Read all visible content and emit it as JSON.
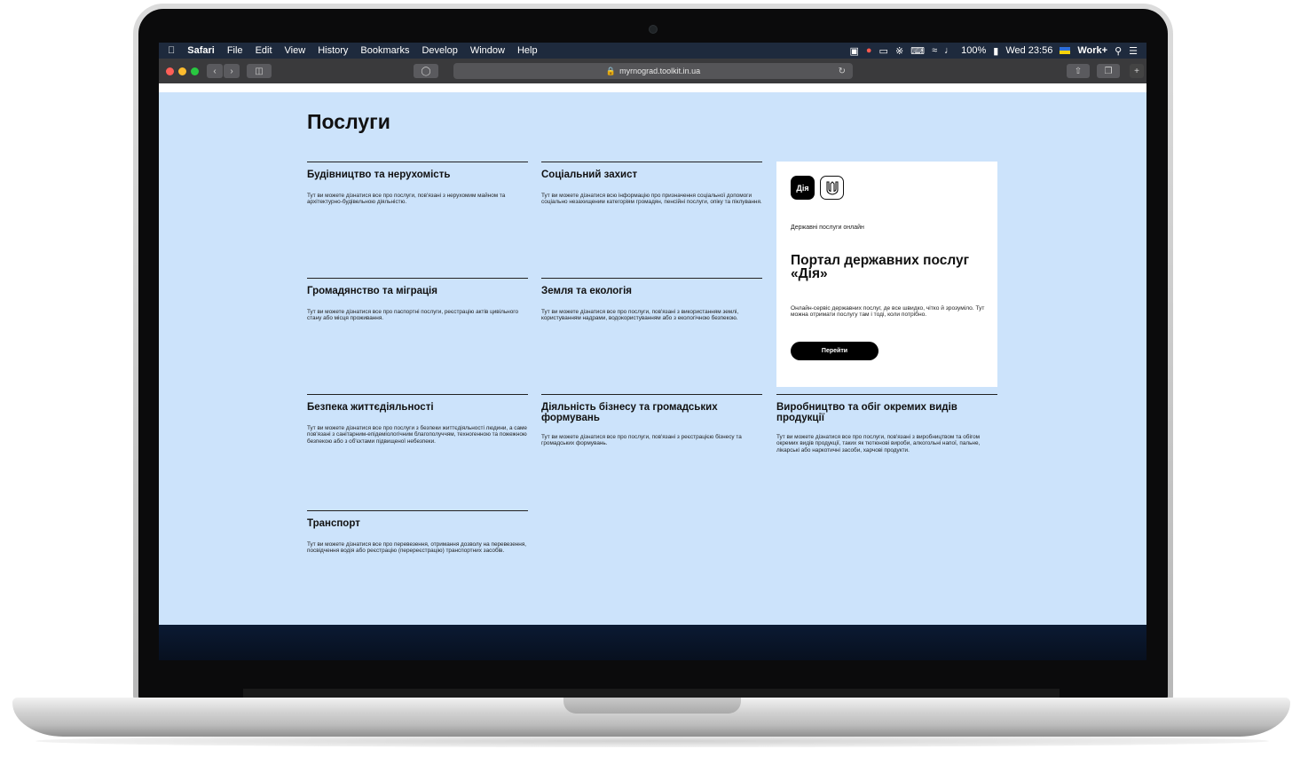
{
  "menubar": {
    "apple": "",
    "app": "Safari",
    "items": [
      "File",
      "Edit",
      "View",
      "History",
      "Bookmarks",
      "Develop",
      "Window",
      "Help"
    ],
    "battery": "100%",
    "clock": "Wed 23:56",
    "profile": "Work+"
  },
  "toolbar": {
    "url": "myrnograd.toolkit.in.ua"
  },
  "page": {
    "heading": "Послуги",
    "services": [
      {
        "title": "Будівництво та нерухомість",
        "desc": "Тут ви можете дізнатися все про послуги, пов'язані з нерухомим майном та архітектурно-будівельною діяльністю."
      },
      {
        "title": "Соціальний захист",
        "desc": "Тут ви можете дізнатися всю інформацію про призначення соціальної допомоги соціально незахищеним категоріям громадян, пенсійні послуги, опіку та піклування."
      },
      {
        "title": "Громадянство та міграція",
        "desc": "Тут ви можете дізнатися все про паспортні послуги, реєстрацію актів цивільного стану або місця проживання."
      },
      {
        "title": "Земля та екологія",
        "desc": "Тут ви можете дізнатися все про послуги, пов'язані з використанням землі, користуванням надрами, водокористуванням або з екологічною безпекою."
      },
      {
        "title": "Безпека життєдіяльності",
        "desc": "Тут ви можете дізнатися все про послуги з безпеки життєдіяльності людини, а саме пов'язані з санітарним-епідеміологічним благополуччям, техногенною та пожежною безпекою або з об'єктами підвищеної небезпеки."
      },
      {
        "title": "Діяльність бізнесу та громадських формувань",
        "desc": "Тут ви можете дізнатися все про послуги, пов'язані з реєстрацією бізнесу та громадських формувань."
      },
      {
        "title": "Виробництво та обіг окремих видів продукції",
        "desc": "Тут ви можете дізнатися все про послуги, пов'язані з виробництвом та обігом окремих видів продукції, таких як тютюнові вироби, алкогольні напої, пальне, лікарські або наркотичні засоби, харчові продукти."
      },
      {
        "title": "Транспорт",
        "desc": "Тут ви можете дізнатися все про перевезення, отримання дозволу на перевезення, посвідчення водія або реєстрацію (перереєстрацію) транспортних засобів."
      }
    ],
    "diia_card": {
      "logo_text": "Дія",
      "kicker": "Державні послуги онлайн",
      "title": "Портал державних послуг «Дія»",
      "desc": "Онлайн-сервіс державних послуг, де все швидко, чітко й зрозуміло. Тут можна отримати послугу там і тоді, коли потрібно.",
      "button": "Перейти"
    }
  },
  "colors": {
    "page_bg": "#cce3fb",
    "card_bg": "#ffffff",
    "button_bg": "#000000"
  }
}
